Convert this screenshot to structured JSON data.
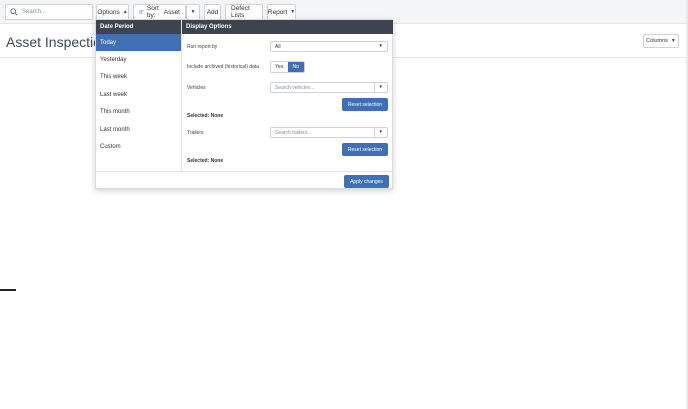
{
  "toolbar": {
    "search_placeholder": "Search...",
    "options_label": "Options",
    "sort_label": "Sort by:",
    "sort_value": "Asset",
    "add_label": "Add",
    "defect_lists_label": "Defect Lists",
    "report_label": "Report"
  },
  "page": {
    "title": "Asset Inspection",
    "columns_label": "Columns"
  },
  "panel": {
    "date_period_header": "Date Period",
    "display_options_header": "Display Options",
    "periods": [
      "Today",
      "Yesterday",
      "This week",
      "Last week",
      "This month",
      "Last month",
      "Custom"
    ],
    "active_period": "Today",
    "run_report_label": "Run report by",
    "run_report_value": "All",
    "archived_label": "Include archived (historical) data",
    "yes_label": "Yes",
    "no_label": "No",
    "vehicles_label": "Vehicles",
    "vehicles_placeholder": "Search vehicles...",
    "reset_label": "Reset selection",
    "vehicles_selected": "Selected: None",
    "trailers_label": "Trailers",
    "trailers_placeholder": "Search trailers...",
    "trailers_selected": "Selected: None",
    "apply_label": "Apply changes"
  },
  "colors": {
    "accent": "#3f6fb5",
    "header_dark": "#3d4450"
  }
}
